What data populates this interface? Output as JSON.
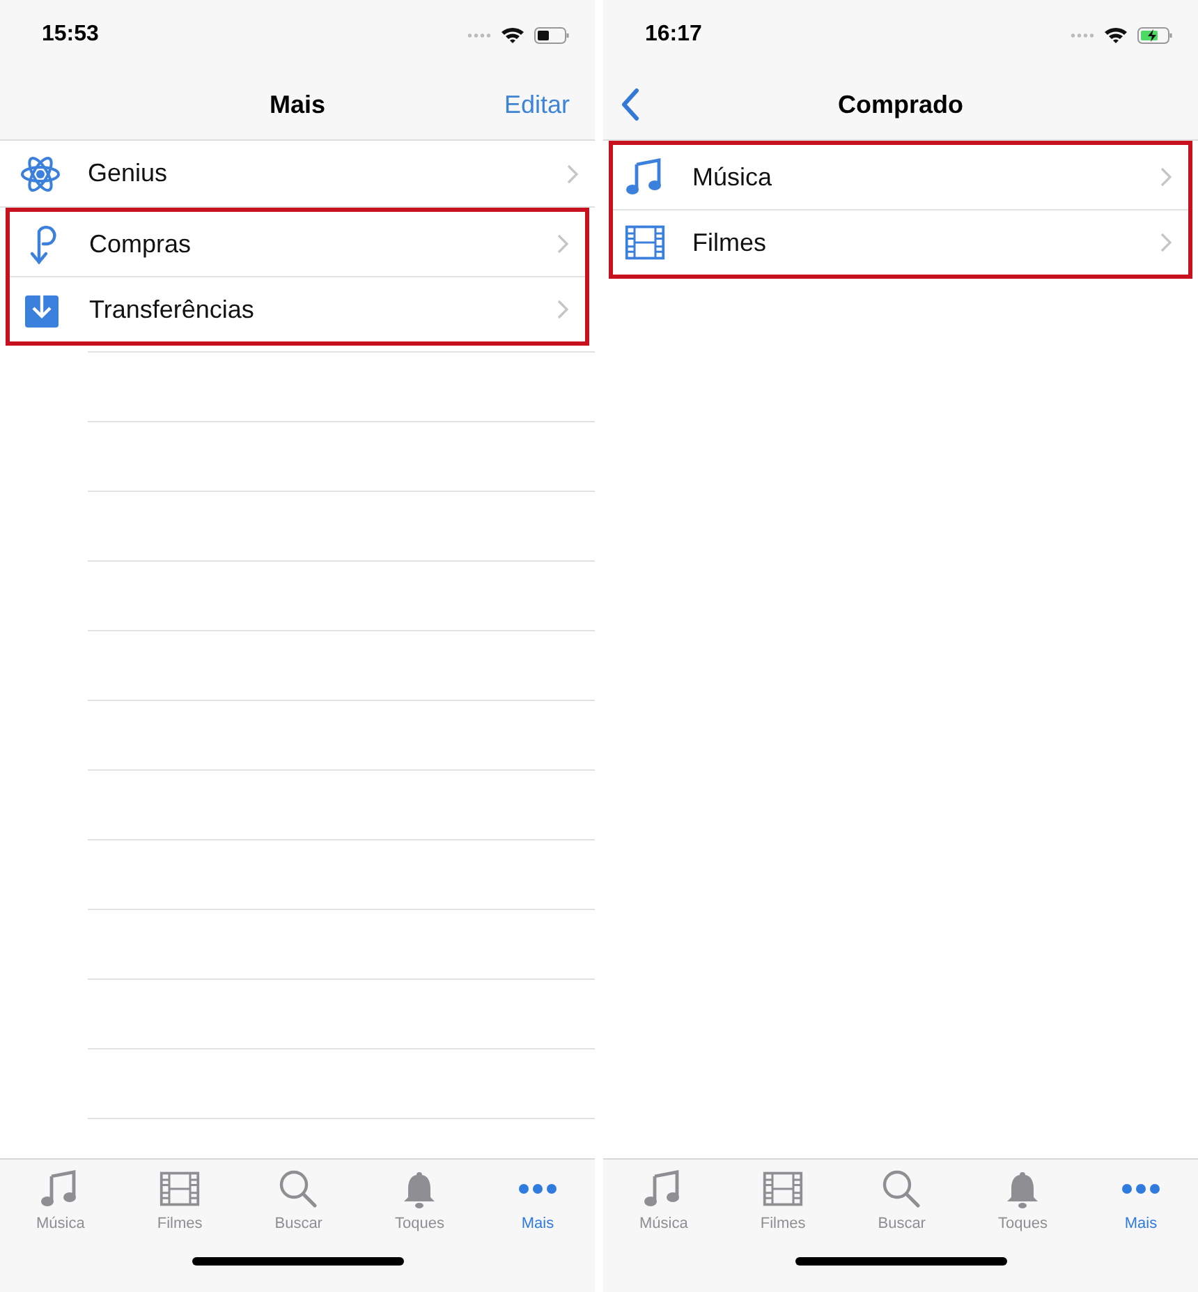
{
  "screens": [
    {
      "status_bar": {
        "time": "15:53",
        "charging": false
      },
      "nav_bar": {
        "back": false,
        "title": "Mais",
        "action": "Editar"
      },
      "list": {
        "empty_separators": true,
        "items": [
          {
            "kind": "atom",
            "label": "Genius",
            "highlighted": false
          },
          {
            "kind": "purchase",
            "label": "Compras",
            "highlighted": true
          },
          {
            "kind": "download",
            "label": "Transferências",
            "highlighted": true
          }
        ]
      },
      "tab_bar": [
        {
          "kind": "note",
          "label": "Música",
          "selected": false
        },
        {
          "kind": "film",
          "label": "Filmes",
          "selected": false
        },
        {
          "kind": "search",
          "label": "Buscar",
          "selected": false
        },
        {
          "kind": "bell",
          "label": "Toques",
          "selected": false
        },
        {
          "kind": "more",
          "label": "Mais",
          "selected": true
        }
      ]
    },
    {
      "status_bar": {
        "time": "16:17",
        "charging": true
      },
      "nav_bar": {
        "back": true,
        "title": "Comprado"
      },
      "list": {
        "empty_separators": false,
        "items": [
          {
            "kind": "note",
            "label": "Música",
            "highlighted": true
          },
          {
            "kind": "film",
            "label": "Filmes",
            "highlighted": true
          }
        ]
      },
      "tab_bar": [
        {
          "kind": "note",
          "label": "Música",
          "selected": false
        },
        {
          "kind": "film",
          "label": "Filmes",
          "selected": false
        },
        {
          "kind": "search",
          "label": "Buscar",
          "selected": false
        },
        {
          "kind": "bell",
          "label": "Toques",
          "selected": false
        },
        {
          "kind": "more",
          "label": "Mais",
          "selected": true
        }
      ]
    }
  ]
}
